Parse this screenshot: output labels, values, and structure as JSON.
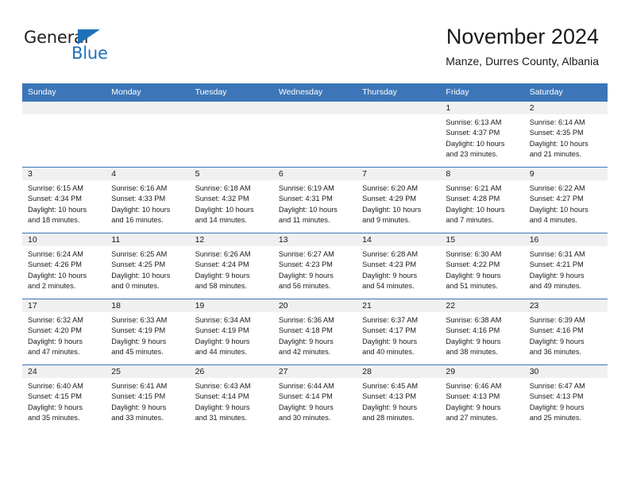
{
  "brand": {
    "name_part1": "General",
    "name_part2": "Blue",
    "accent_color": "#1e71b8"
  },
  "header": {
    "title": "November 2024",
    "subtitle": "Manze, Durres County, Albania"
  },
  "theme": {
    "header_blue": "#3c76b8",
    "daynum_band": "#f0f0f0",
    "text": "#1a1a1a"
  },
  "weekdays": [
    "Sunday",
    "Monday",
    "Tuesday",
    "Wednesday",
    "Thursday",
    "Friday",
    "Saturday"
  ],
  "weeks": [
    [
      {
        "empty": true
      },
      {
        "empty": true
      },
      {
        "empty": true
      },
      {
        "empty": true
      },
      {
        "empty": true
      },
      {
        "day": "1",
        "sunrise": "Sunrise: 6:13 AM",
        "sunset": "Sunset: 4:37 PM",
        "daylight1": "Daylight: 10 hours",
        "daylight2": "and 23 minutes."
      },
      {
        "day": "2",
        "sunrise": "Sunrise: 6:14 AM",
        "sunset": "Sunset: 4:35 PM",
        "daylight1": "Daylight: 10 hours",
        "daylight2": "and 21 minutes."
      }
    ],
    [
      {
        "day": "3",
        "sunrise": "Sunrise: 6:15 AM",
        "sunset": "Sunset: 4:34 PM",
        "daylight1": "Daylight: 10 hours",
        "daylight2": "and 18 minutes."
      },
      {
        "day": "4",
        "sunrise": "Sunrise: 6:16 AM",
        "sunset": "Sunset: 4:33 PM",
        "daylight1": "Daylight: 10 hours",
        "daylight2": "and 16 minutes."
      },
      {
        "day": "5",
        "sunrise": "Sunrise: 6:18 AM",
        "sunset": "Sunset: 4:32 PM",
        "daylight1": "Daylight: 10 hours",
        "daylight2": "and 14 minutes."
      },
      {
        "day": "6",
        "sunrise": "Sunrise: 6:19 AM",
        "sunset": "Sunset: 4:31 PM",
        "daylight1": "Daylight: 10 hours",
        "daylight2": "and 11 minutes."
      },
      {
        "day": "7",
        "sunrise": "Sunrise: 6:20 AM",
        "sunset": "Sunset: 4:29 PM",
        "daylight1": "Daylight: 10 hours",
        "daylight2": "and 9 minutes."
      },
      {
        "day": "8",
        "sunrise": "Sunrise: 6:21 AM",
        "sunset": "Sunset: 4:28 PM",
        "daylight1": "Daylight: 10 hours",
        "daylight2": "and 7 minutes."
      },
      {
        "day": "9",
        "sunrise": "Sunrise: 6:22 AM",
        "sunset": "Sunset: 4:27 PM",
        "daylight1": "Daylight: 10 hours",
        "daylight2": "and 4 minutes."
      }
    ],
    [
      {
        "day": "10",
        "sunrise": "Sunrise: 6:24 AM",
        "sunset": "Sunset: 4:26 PM",
        "daylight1": "Daylight: 10 hours",
        "daylight2": "and 2 minutes."
      },
      {
        "day": "11",
        "sunrise": "Sunrise: 6:25 AM",
        "sunset": "Sunset: 4:25 PM",
        "daylight1": "Daylight: 10 hours",
        "daylight2": "and 0 minutes."
      },
      {
        "day": "12",
        "sunrise": "Sunrise: 6:26 AM",
        "sunset": "Sunset: 4:24 PM",
        "daylight1": "Daylight: 9 hours",
        "daylight2": "and 58 minutes."
      },
      {
        "day": "13",
        "sunrise": "Sunrise: 6:27 AM",
        "sunset": "Sunset: 4:23 PM",
        "daylight1": "Daylight: 9 hours",
        "daylight2": "and 56 minutes."
      },
      {
        "day": "14",
        "sunrise": "Sunrise: 6:28 AM",
        "sunset": "Sunset: 4:23 PM",
        "daylight1": "Daylight: 9 hours",
        "daylight2": "and 54 minutes."
      },
      {
        "day": "15",
        "sunrise": "Sunrise: 6:30 AM",
        "sunset": "Sunset: 4:22 PM",
        "daylight1": "Daylight: 9 hours",
        "daylight2": "and 51 minutes."
      },
      {
        "day": "16",
        "sunrise": "Sunrise: 6:31 AM",
        "sunset": "Sunset: 4:21 PM",
        "daylight1": "Daylight: 9 hours",
        "daylight2": "and 49 minutes."
      }
    ],
    [
      {
        "day": "17",
        "sunrise": "Sunrise: 6:32 AM",
        "sunset": "Sunset: 4:20 PM",
        "daylight1": "Daylight: 9 hours",
        "daylight2": "and 47 minutes."
      },
      {
        "day": "18",
        "sunrise": "Sunrise: 6:33 AM",
        "sunset": "Sunset: 4:19 PM",
        "daylight1": "Daylight: 9 hours",
        "daylight2": "and 45 minutes."
      },
      {
        "day": "19",
        "sunrise": "Sunrise: 6:34 AM",
        "sunset": "Sunset: 4:19 PM",
        "daylight1": "Daylight: 9 hours",
        "daylight2": "and 44 minutes."
      },
      {
        "day": "20",
        "sunrise": "Sunrise: 6:36 AM",
        "sunset": "Sunset: 4:18 PM",
        "daylight1": "Daylight: 9 hours",
        "daylight2": "and 42 minutes."
      },
      {
        "day": "21",
        "sunrise": "Sunrise: 6:37 AM",
        "sunset": "Sunset: 4:17 PM",
        "daylight1": "Daylight: 9 hours",
        "daylight2": "and 40 minutes."
      },
      {
        "day": "22",
        "sunrise": "Sunrise: 6:38 AM",
        "sunset": "Sunset: 4:16 PM",
        "daylight1": "Daylight: 9 hours",
        "daylight2": "and 38 minutes."
      },
      {
        "day": "23",
        "sunrise": "Sunrise: 6:39 AM",
        "sunset": "Sunset: 4:16 PM",
        "daylight1": "Daylight: 9 hours",
        "daylight2": "and 36 minutes."
      }
    ],
    [
      {
        "day": "24",
        "sunrise": "Sunrise: 6:40 AM",
        "sunset": "Sunset: 4:15 PM",
        "daylight1": "Daylight: 9 hours",
        "daylight2": "and 35 minutes."
      },
      {
        "day": "25",
        "sunrise": "Sunrise: 6:41 AM",
        "sunset": "Sunset: 4:15 PM",
        "daylight1": "Daylight: 9 hours",
        "daylight2": "and 33 minutes."
      },
      {
        "day": "26",
        "sunrise": "Sunrise: 6:43 AM",
        "sunset": "Sunset: 4:14 PM",
        "daylight1": "Daylight: 9 hours",
        "daylight2": "and 31 minutes."
      },
      {
        "day": "27",
        "sunrise": "Sunrise: 6:44 AM",
        "sunset": "Sunset: 4:14 PM",
        "daylight1": "Daylight: 9 hours",
        "daylight2": "and 30 minutes."
      },
      {
        "day": "28",
        "sunrise": "Sunrise: 6:45 AM",
        "sunset": "Sunset: 4:13 PM",
        "daylight1": "Daylight: 9 hours",
        "daylight2": "and 28 minutes."
      },
      {
        "day": "29",
        "sunrise": "Sunrise: 6:46 AM",
        "sunset": "Sunset: 4:13 PM",
        "daylight1": "Daylight: 9 hours",
        "daylight2": "and 27 minutes."
      },
      {
        "day": "30",
        "sunrise": "Sunrise: 6:47 AM",
        "sunset": "Sunset: 4:13 PM",
        "daylight1": "Daylight: 9 hours",
        "daylight2": "and 25 minutes."
      }
    ]
  ]
}
